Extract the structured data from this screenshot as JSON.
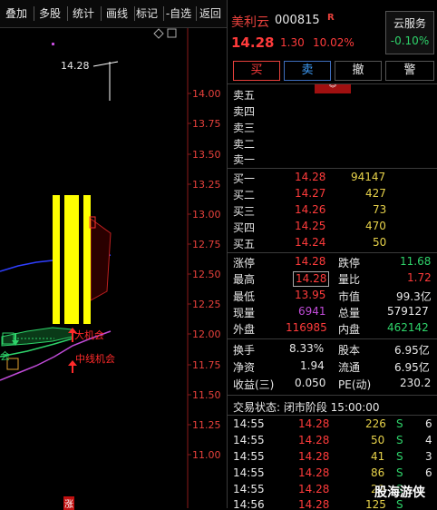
{
  "toolbar": {
    "items": [
      "叠加",
      "多股",
      "统计",
      "画线",
      "标记",
      "-自选",
      "返回"
    ]
  },
  "chart": {
    "price_ticks": [
      "14.00",
      "13.75",
      "13.50",
      "13.25",
      "13.00",
      "12.75",
      "12.50",
      "12.25",
      "12.00",
      "11.75",
      "11.50",
      "11.25",
      "11.00"
    ],
    "high_label": "14.28",
    "signal_big": "大机会",
    "signal_mid": "中线机会",
    "signal_left": "会",
    "bottom_glyph": "涨",
    "colors": {
      "candle": "#ffff00",
      "ma_blue": "#2f3fff",
      "ma_purple": "#c04bd8",
      "signal": "#ff2a2a"
    }
  },
  "stock": {
    "name": "美利云",
    "code": "000815",
    "badge": "R",
    "price": "14.28",
    "change": "1.30",
    "change_pct": "10.02%",
    "cloud_label": "云服务",
    "cloud_value": "-0.10%"
  },
  "buttons": {
    "buy": "买",
    "sell": "卖",
    "cancel": "撤",
    "alert": "警"
  },
  "sell_levels": [
    {
      "label": "卖五"
    },
    {
      "label": "卖四"
    },
    {
      "label": "卖三"
    },
    {
      "label": "卖二"
    },
    {
      "label": "卖一"
    }
  ],
  "buy_levels": [
    {
      "label": "买一",
      "price": "14.28",
      "vol": "94147"
    },
    {
      "label": "买二",
      "price": "14.27",
      "vol": "427"
    },
    {
      "label": "买三",
      "price": "14.26",
      "vol": "73"
    },
    {
      "label": "买四",
      "price": "14.25",
      "vol": "470"
    },
    {
      "label": "买五",
      "price": "14.24",
      "vol": "50"
    }
  ],
  "stats": [
    {
      "l1": "涨停",
      "v1": "14.28",
      "l2": "跌停",
      "v2": "11.68"
    },
    {
      "l1": "最高",
      "v1": "14.28",
      "l2": "量比",
      "v2": "1.72"
    },
    {
      "l1": "最低",
      "v1": "13.95",
      "l2": "市值",
      "v2": "99.3亿"
    },
    {
      "l1": "现量",
      "v1": "6941",
      "l2": "总量",
      "v2": "579127"
    },
    {
      "l1": "外盘",
      "v1": "116985",
      "l2": "内盘",
      "v2": "462142"
    }
  ],
  "stats2": [
    {
      "l1": "换手",
      "v1": "8.33%",
      "l2": "股本",
      "v2": "6.95亿"
    },
    {
      "l1": "净资",
      "v1": "1.94",
      "l2": "流通",
      "v2": "6.95亿"
    },
    {
      "l1": "收益(三)",
      "v1": "0.050",
      "l2": "PE(动)",
      "v2": "230.2"
    }
  ],
  "trade_status": "交易状态: 闭市阶段 15:00:00",
  "ticks": [
    {
      "time": "14:55",
      "price": "14.28",
      "vol": "226",
      "side": "S",
      "n": "6"
    },
    {
      "time": "14:55",
      "price": "14.28",
      "vol": "50",
      "side": "S",
      "n": "4"
    },
    {
      "time": "14:55",
      "price": "14.28",
      "vol": "41",
      "side": "S",
      "n": "3"
    },
    {
      "time": "14:55",
      "price": "14.28",
      "vol": "86",
      "side": "S",
      "n": "6"
    },
    {
      "time": "14:55",
      "price": "14.28",
      "vol": "29",
      "side": "S",
      "n": ""
    },
    {
      "time": "14:56",
      "price": "14.28",
      "vol": "125",
      "side": "S",
      "n": ""
    }
  ],
  "watermark": "股海游侠"
}
